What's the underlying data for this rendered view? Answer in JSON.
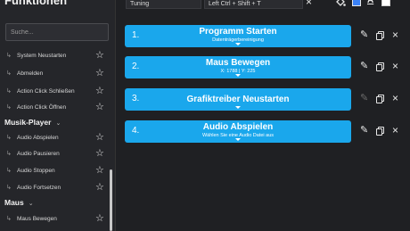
{
  "sidebar": {
    "title": "Funktionen",
    "search_placeholder": "Suche...",
    "items": [
      {
        "label": "System Neustarten"
      },
      {
        "label": "Abmelden"
      },
      {
        "label": "Action Click Schließen"
      },
      {
        "label": "Action Click Öffnen"
      }
    ],
    "categories": [
      {
        "label": "Musik-Player",
        "items": [
          {
            "label": "Audio Abspielen"
          },
          {
            "label": "Audio Pausieren"
          },
          {
            "label": "Audio Stoppen"
          },
          {
            "label": "Audio Fortsetzen"
          }
        ]
      },
      {
        "label": "Maus",
        "items": [
          {
            "label": "Maus Bewegen"
          }
        ]
      }
    ],
    "item_arrow": "↳",
    "star_icon": "☆",
    "chevron_icon": "⌄"
  },
  "toolbar": {
    "name_value": "Tuning",
    "hotkey_value": "Left Ctrl + Shift + T",
    "clear_icon": "×",
    "fill_color": "#3b82f6",
    "text_color": "#ffffff"
  },
  "actions": [
    {
      "number": "1.",
      "title": "Programm Starten",
      "subtitle": "Datenträgerbereinigung"
    },
    {
      "number": "2.",
      "title": "Maus Bewegen",
      "subtitle": "X: 1788 | Y: 225"
    },
    {
      "number": "3.",
      "title": "Grafiktreiber Neustarten",
      "subtitle": ""
    },
    {
      "number": "4.",
      "title": "Audio Abspielen",
      "subtitle": "Wählen Sie eine Audio Datei aus"
    }
  ],
  "action_icons": {
    "edit": "✎",
    "close": "×"
  }
}
